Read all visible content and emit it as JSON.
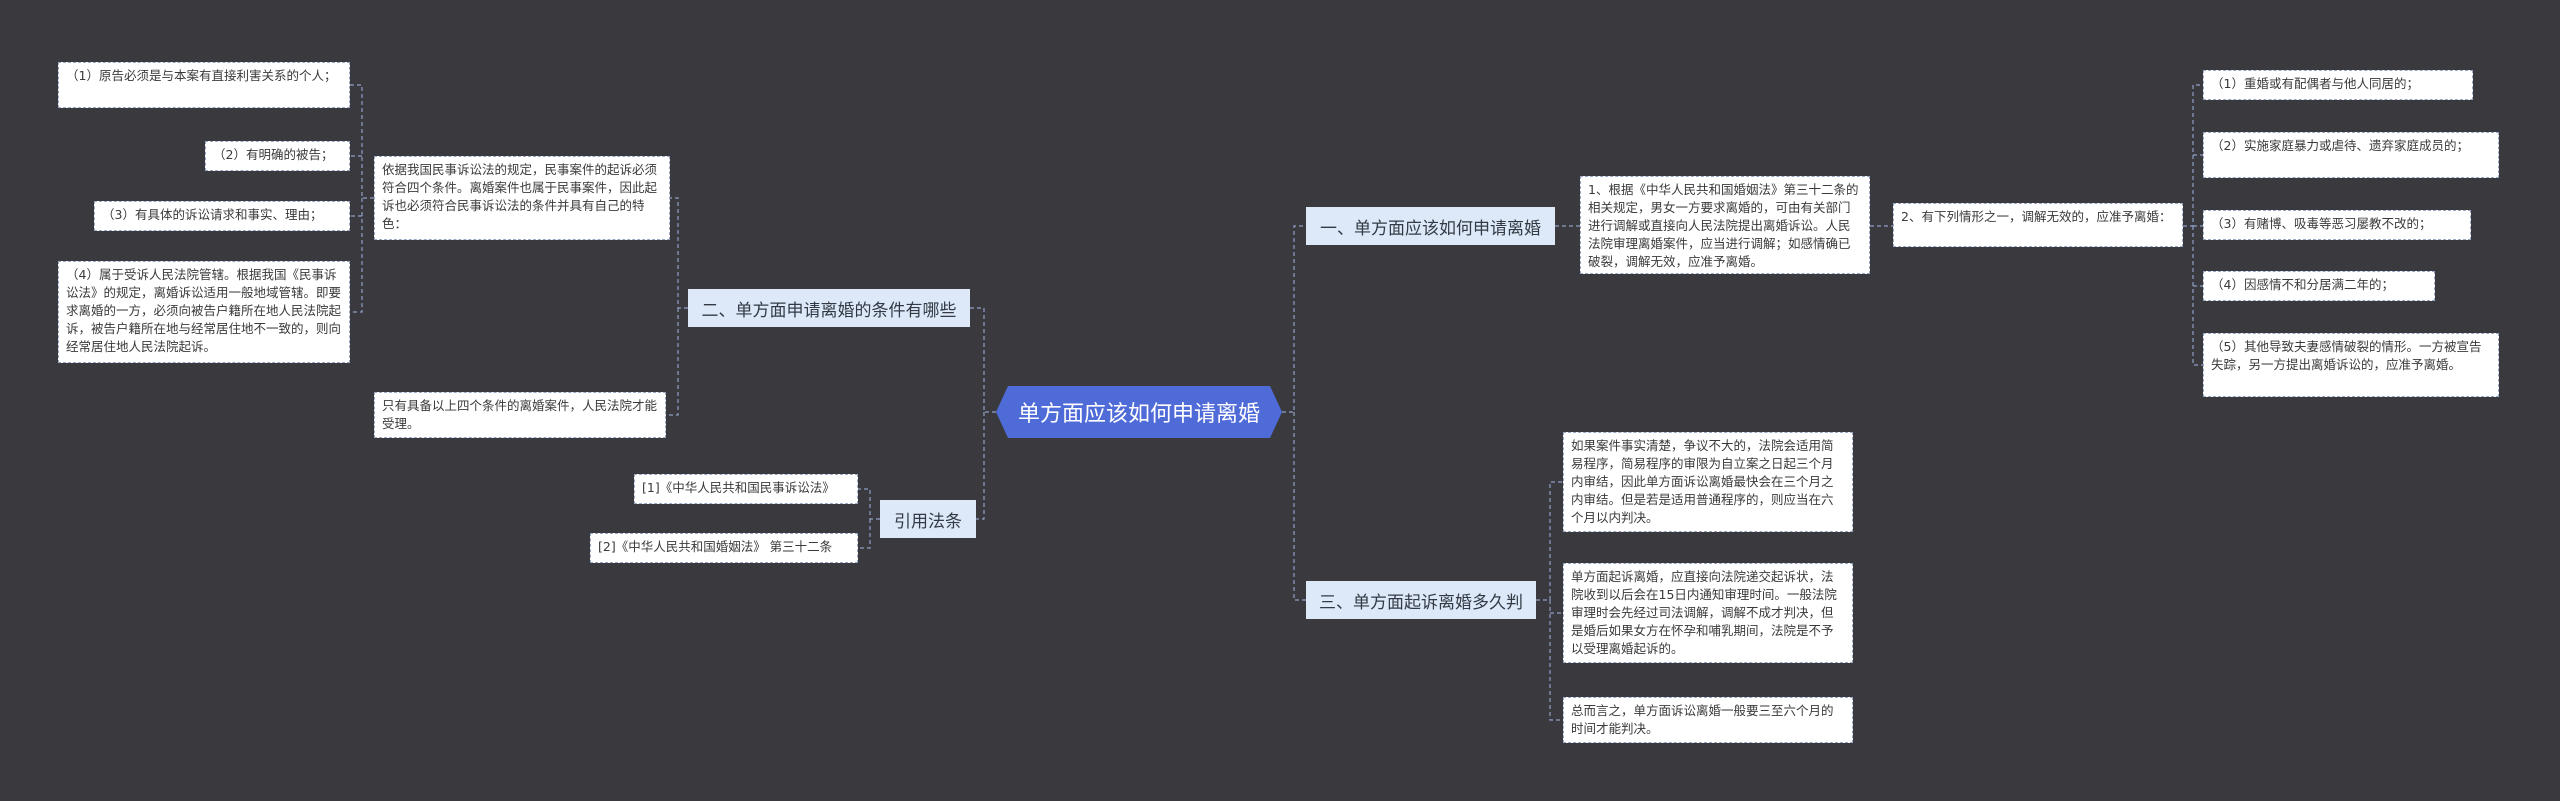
{
  "root": {
    "label": "单方面应该如何申请离婚"
  },
  "colors": {
    "background": "#3a393d",
    "root": "#4f6bd8",
    "branch": "#dde9f8",
    "leaf": "#ffffff",
    "line": "#8fa0c8"
  },
  "branches": {
    "b1": "一、单方面应该如何申请离婚",
    "b2": "二、单方面申请离婚的条件有哪些",
    "b3": "三、单方面起诉离婚多久判",
    "b4": "引用法条"
  },
  "b1": {
    "law": "1、根据《中华人民共和国婚姻法》第三十二条的相关规定，男女一方要求离婚的，可由有关部门进行调解或直接向人民法院提出离婚诉讼。人民法院审理离婚案件，应当进行调解；如感情确已破裂，调解无效，应准予离婚。",
    "cases_intro": "2、有下列情形之一，调解无效的，应准予离婚：",
    "cases": [
      "（1）重婚或有配偶者与他人同居的；",
      "（2）实施家庭暴力或虐待、遗弃家庭成员的；",
      "（3）有赌博、吸毒等恶习屡教不改的；",
      "（4）因感情不和分居满二年的；",
      "（5）其他导致夫妻感情破裂的情形。一方被宣告失踪，另一方提出离婚诉讼的，应准予离婚。"
    ]
  },
  "b2": {
    "intro": "依据我国民事诉讼法的规定，民事案件的起诉必须符合四个条件。离婚案件也属于民事案件，因此起诉也必须符合民事诉讼法的条件并具有自己的特色：",
    "conditions": [
      "（1）原告必须是与本案有直接利害关系的个人；",
      "（2）有明确的被告；",
      "（3）有具体的诉讼请求和事实、理由；",
      "（4）属于受诉人民法院管辖。根据我国《民事诉讼法》的规定，离婚诉讼适用一般地域管辖。即要求离婚的一方，必须向被告户籍所在地人民法院起诉，被告户籍所在地与经常居住地不一致的，则向经常居住地人民法院起诉。"
    ],
    "note": "只有具备以上四个条件的离婚案件，人民法院才能受理。"
  },
  "b3": {
    "items": [
      "如果案件事实清楚，争议不大的，法院会适用简易程序，简易程序的审限为自立案之日起三个月内审结，因此单方面诉讼离婚最快会在三个月之内审结。但是若是适用普通程序的，则应当在六个月以内判决。",
      "单方面起诉离婚，应直接向法院递交起诉状，法院收到以后会在15日内通知审理时间。一般法院审理时会先经过司法调解，调解不成才判决，但是婚后如果女方在怀孕和哺乳期间，法院是不予以受理离婚起诉的。",
      "总而言之，单方面诉讼离婚一般要三至六个月的时间才能判决。"
    ]
  },
  "b4": {
    "items": [
      "[1]《中华人民共和国民事诉讼法》",
      "[2]《中华人民共和国婚姻法》 第三十二条"
    ]
  }
}
